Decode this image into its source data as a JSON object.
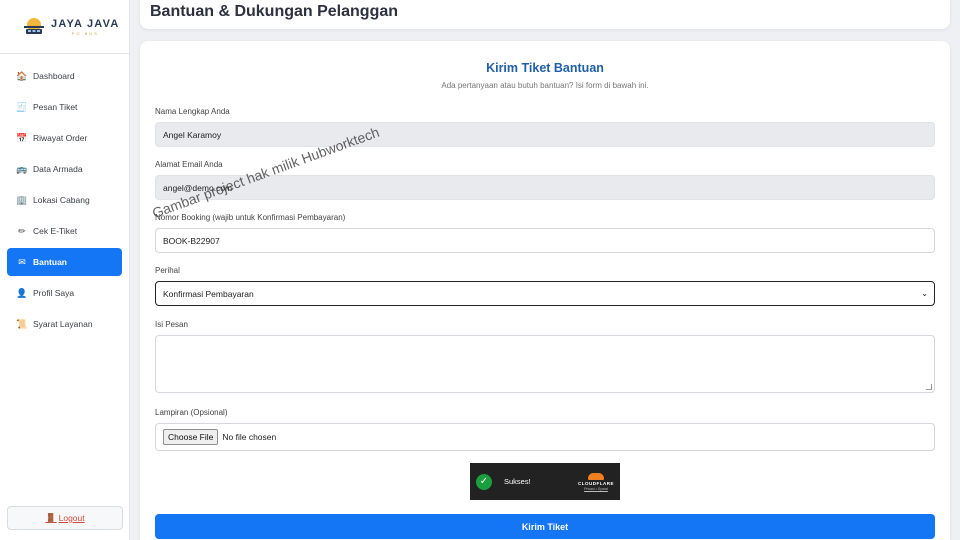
{
  "brand": {
    "title": "JAYA JAVA",
    "subtitle": "PO BUS"
  },
  "sidebar": {
    "items": [
      {
        "label": "Dashboard",
        "icon": "home-icon",
        "glyph": "🏠"
      },
      {
        "label": "Pesan Tiket",
        "icon": "ticket-icon",
        "glyph": "🧾"
      },
      {
        "label": "Riwayat Order",
        "icon": "calendar-icon",
        "glyph": "📅"
      },
      {
        "label": "Data Armada",
        "icon": "bus-icon",
        "glyph": "🚌"
      },
      {
        "label": "Lokasi Cabang",
        "icon": "building-icon",
        "glyph": "🏢"
      },
      {
        "label": "Cek E-Tiket",
        "icon": "pen-icon",
        "glyph": "✏"
      },
      {
        "label": "Bantuan",
        "icon": "mail-icon",
        "glyph": "✉",
        "active": true
      },
      {
        "label": "Profil Saya",
        "icon": "user-icon",
        "glyph": "👤"
      },
      {
        "label": "Syarat Layanan",
        "icon": "scroll-icon",
        "glyph": "📜"
      }
    ],
    "logout_label": "Logout"
  },
  "header": {
    "title": "Bantuan & Dukungan Pelanggan"
  },
  "form": {
    "title": "Kirim Tiket Bantuan",
    "subtitle": "Ada pertanyaan atau butuh bantuan? Isi form di bawah ini.",
    "name_label": "Nama Lengkap Anda",
    "name_value": "Angel Karamoy",
    "email_label": "Alamat Email Anda",
    "email_value": "angel@demo.com",
    "booking_label": "Nomor Booking (wajib untuk Konfirmasi Pembayaran)",
    "booking_value": "BOOK-B22907",
    "subject_label": "Perihal",
    "subject_value": "Konfirmasi Pembayaran",
    "message_label": "Isi Pesan",
    "message_value": "",
    "attachment_label": "Lampiran (Opsional)",
    "file_button": "Choose File",
    "file_status": "No file chosen",
    "captcha_status": "Sukses!",
    "captcha_brand": "CLOUDFLARE",
    "captcha_links": "Privasi • Syarat",
    "submit_label": "Kirim Tiket"
  },
  "watermark": "Gambar project hak milik Hubworktech",
  "colors": {
    "accent": "#1475f5",
    "title_blue": "#1f5ea8",
    "logout_red": "#d6483c",
    "success": "#1a9e3e",
    "cloudflare": "#f38020"
  }
}
